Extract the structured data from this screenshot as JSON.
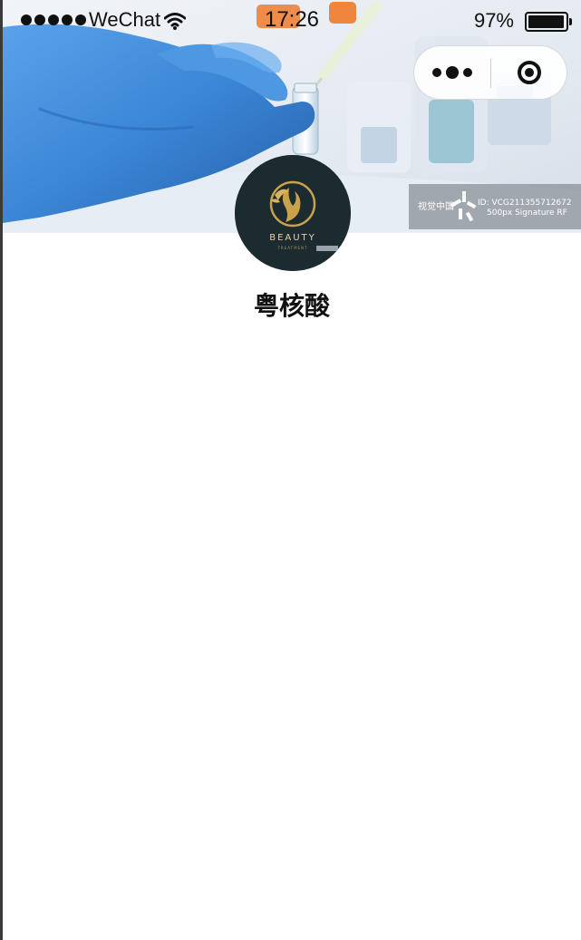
{
  "statusbar": {
    "carrier": "WeChat",
    "time": "17:26",
    "battery_percent": "97%",
    "signal_icon": "signal-dots-icon",
    "wifi_icon": "wifi-icon",
    "battery_icon": "battery-icon",
    "battery_level": 0.97
  },
  "capsule": {
    "more_icon": "more-dots-icon",
    "close_icon": "target-circle-icon"
  },
  "hero": {
    "watermark_brand": "视觉中国",
    "watermark_id": "ID: VCG211355712672",
    "watermark_license": "500px Signature RF"
  },
  "profile": {
    "avatar_text": "BEAUTY",
    "avatar_subtext": "TREATMENT",
    "name": "粤核酸"
  },
  "colors": {
    "glove": "#3f8ad8",
    "avatar_bg": "#1c2b2f",
    "logo_gold": "#c9a24c",
    "orange_caps": "#f07a2a"
  }
}
